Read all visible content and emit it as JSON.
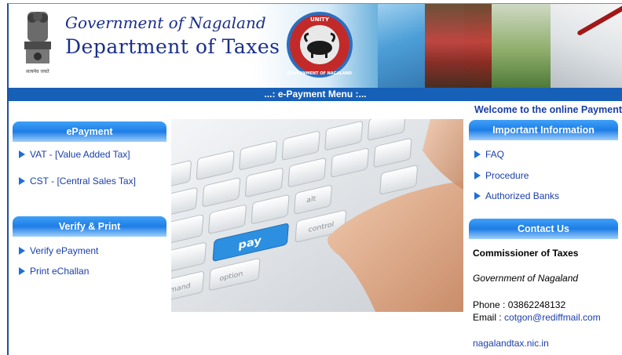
{
  "header": {
    "title_line1": "Government of Nagaland",
    "title_line2": "Department of Taxes",
    "emblem_caption": "सत्यमेव जयते",
    "seal_top_text": "UNITY",
    "seal_bottom_text": "GOVERNMENT OF NAGALAND"
  },
  "menubar": {
    "label": "...: e-Payment Menu :..."
  },
  "welcome": "Welcome to the online Payment",
  "left": {
    "epayment": {
      "heading": "ePayment",
      "items": [
        {
          "label": "VAT - [Value Added Tax]"
        },
        {
          "label": "CST - [Central Sales Tax]"
        }
      ]
    },
    "verify": {
      "heading": "Verify & Print",
      "items": [
        {
          "label": "Verify ePayment"
        },
        {
          "label": "Print eChallan"
        }
      ]
    }
  },
  "center": {
    "key_pay": "pay",
    "key_control": "control",
    "key_option": "option",
    "key_command": "command",
    "key_alt": "alt"
  },
  "right": {
    "info": {
      "heading": "Important Information",
      "items": [
        {
          "label": "FAQ"
        },
        {
          "label": "Procedure"
        },
        {
          "label": "Authorized Banks"
        }
      ]
    },
    "contact": {
      "heading": "Contact Us",
      "name": "Commissioner of Taxes",
      "org": "Government of Nagaland",
      "phone": "Phone : 03862248132",
      "email_label": "Email : ",
      "email": "cotgon@rediffmail.com",
      "website": "nagalandtax.nic.in"
    }
  },
  "colors": {
    "accent": "#1760b8",
    "link": "#1a3ea8",
    "panel": "#1e7de6"
  }
}
